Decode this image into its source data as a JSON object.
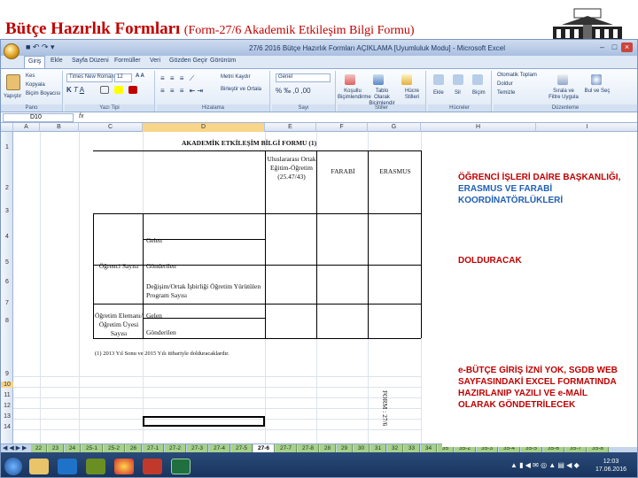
{
  "slide": {
    "title_main": "Bütçe Hazırlık Formları",
    "title_sub": "(Form-27/6 Akademik Etkileşim Bilgi Formu)"
  },
  "window": {
    "title": "27/6 2016 Bütçe Hazırlık Formları AÇIKLAMA [Uyumluluk Modu] - Microsoft Excel"
  },
  "ribbon": {
    "tabs": [
      "Giriş",
      "Ekle",
      "Sayfa Düzeni",
      "Formüller",
      "Veri",
      "Gözden Geçir",
      "Görünüm"
    ],
    "groups": [
      "Pano",
      "Yazı Tipi",
      "Hizalama",
      "Sayı",
      "Stiller",
      "Hücreler",
      "Düzenleme"
    ],
    "clipboard": {
      "paste": "Yapıştır",
      "cut": "Kes",
      "copy": "Kopyala",
      "format_painter": "Biçim Boyacısı"
    },
    "font": {
      "name": "Times New Roman",
      "size": "12"
    },
    "alignment": {
      "wrap": "Metni Kaydır",
      "merge": "Birleştir ve Ortala"
    },
    "number": {
      "format": "Genel"
    },
    "styles": {
      "conditional": "Koşullu Biçimlendirme",
      "table": "Tablo Olarak Biçimlendir",
      "cell": "Hücre Stilleri"
    },
    "cells": {
      "insert": "Ekle",
      "delete": "Sil",
      "format": "Biçim"
    },
    "editing": {
      "autosum": "Otomatik Toplam",
      "fill": "Doldur",
      "clear": "Temizle",
      "sort": "Sırala ve Filtre Uygula",
      "find": "Bul ve Seç"
    }
  },
  "formula_bar": {
    "cell_ref": "D10",
    "fx": "fx"
  },
  "columns": [
    "A",
    "B",
    "C",
    "D",
    "E",
    "F",
    "G",
    "H",
    "I"
  ],
  "rows": [
    "1",
    "2",
    "3",
    "4",
    "5",
    "6",
    "7",
    "8",
    "9",
    "10",
    "11",
    "12",
    "13",
    "14"
  ],
  "form": {
    "heading": "AKADEMİK ETKİLEŞİM BİLGİ FORMU (1)",
    "col1": "Uluslararası Ortak Eğitim-Öğretim (25.47/43)",
    "col2": "FARABİ",
    "col3": "ERASMUS",
    "student_label": "Öğrenci Sayısı",
    "staff_label": "Öğretim Elemanı/ Öğretim Üyesi Sayısı",
    "row_incoming": "Gelen",
    "row_outgoing": "Gönderilen",
    "row_exchange": "Değişim/Ortak İşbirliği Öğretim Yürütülen Program Sayısı",
    "row_staff_in": "Gelen",
    "row_staff_out": "Gönderilen",
    "footnote": "(1) 2013 Yıl Sonu ve 2015 Yılı itibariyle dolduracaklardır.",
    "side_label": "FORM : 27/6"
  },
  "notes": {
    "line1": "ÖĞRENCİ İŞLERİ DAİRE BAŞKANLIĞI,",
    "line2": "ERASMUS VE FARABİ",
    "line3": "KOORDİNATÖRLÜKLERİ",
    "line4": "DOLDURACAK",
    "line5": "e-BÜTÇE GİRİŞ İZNİ YOK, SGDB WEB",
    "line6": "SAYFASINDAKİ EXCEL FORMATINDA",
    "line7": "HAZIRLANIP YAZILI VE e-MAİL",
    "line8": "OLARAK GÖNDETRİLECEK",
    "color_blue": "#1f5fb4",
    "color_red": "#c00000"
  },
  "sheet_tabs": [
    "22",
    "23",
    "24",
    "25-1",
    "25-2",
    "26",
    "27-1",
    "27-2",
    "27-3",
    "27-4",
    "27-5",
    "27-6",
    "27-7",
    "27-8",
    "28",
    "29",
    "30",
    "31",
    "32",
    "33",
    "34",
    "35",
    "35-2",
    "35-3",
    "35-4",
    "35-5",
    "35-6",
    "35-7",
    "35-8"
  ],
  "taskbar": {
    "time": "12:03",
    "date": "17.06.2016"
  },
  "colors": {
    "title_red": "#c00000",
    "sheet_tab_green": "#a8d08d",
    "ribbon_blue": "#dfe8f5"
  }
}
